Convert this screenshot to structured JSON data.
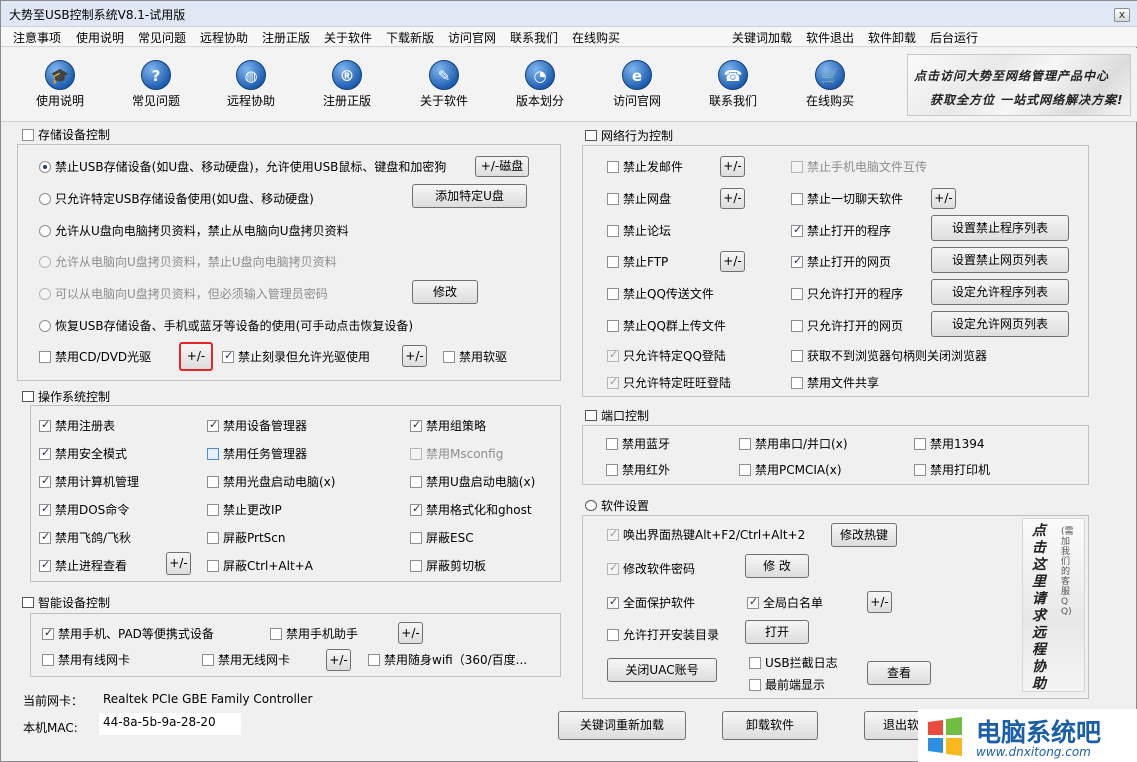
{
  "window": {
    "title": "大势至USB控制系统V8.1-试用版",
    "close": "x"
  },
  "menu": [
    "注意事项",
    "使用说明",
    "常见问题",
    "远程协助",
    "注册正版",
    "关于软件",
    "下载新版",
    "访问官网",
    "联系我们",
    "在线购买"
  ],
  "menu_right": [
    "关键词加载",
    "软件退出",
    "软件卸载",
    "后台运行"
  ],
  "toolbar": [
    {
      "label": "使用说明",
      "icon": "graduation-icon",
      "glyph": "🎓"
    },
    {
      "label": "常见问题",
      "icon": "question-icon",
      "glyph": "?"
    },
    {
      "label": "远程协助",
      "icon": "globe-icon",
      "glyph": "◍"
    },
    {
      "label": "注册正版",
      "icon": "registered-icon",
      "glyph": "®"
    },
    {
      "label": "关于软件",
      "icon": "edit-icon",
      "glyph": "✎"
    },
    {
      "label": "版本划分",
      "icon": "pie-chart-icon",
      "glyph": "◔"
    },
    {
      "label": "访问官网",
      "icon": "ie-icon",
      "glyph": "e"
    },
    {
      "label": "联系我们",
      "icon": "phone-icon",
      "glyph": "☎"
    },
    {
      "label": "在线购买",
      "icon": "cart-icon",
      "glyph": "🛒"
    }
  ],
  "banner": {
    "line1": "点击访问大势至网络管理产品中心",
    "line2": "获取全方位 一站式网络解决方案!"
  },
  "storage": {
    "title": "存储设备控制",
    "options": [
      "禁止USB存储设备(如U盘、移动硬盘)，允许使用USB鼠标、键盘和加密狗",
      "只允许特定USB存储设备使用(如U盘、移动硬盘)",
      "允许从U盘向电脑拷贝资料，禁止从电脑向U盘拷贝资料",
      "允许从电脑向U盘拷贝资料，禁止U盘向电脑拷贝资料",
      "可以从电脑向U盘拷贝资料，但必须输入管理员密码",
      "恢复USB存储设备、手机或蓝牙等设备的使用(可手动点击恢复设备)"
    ],
    "btn_disk": "+/-磁盘",
    "btn_add_udisk": "添加特定U盘",
    "btn_modify": "修改",
    "cd_dvd": "禁用CD/DVD光驱",
    "btn_pm1": "+/-",
    "burn": "禁止刻录但允许光驱使用",
    "btn_pm2": "+/-",
    "floppy": "禁用软驱"
  },
  "os": {
    "title": "操作系统控制",
    "items": [
      "禁用注册表",
      "禁用设备管理器",
      "禁用组策略",
      "禁用安全模式",
      "禁用任务管理器",
      "禁用Msconfig",
      "禁用计算机管理",
      "禁用光盘启动电脑(x)",
      "禁用U盘启动电脑(x)",
      "禁用DOS命令",
      "禁止更改IP",
      "禁用格式化和ghost",
      "禁用飞鸽/飞秋",
      "屏蔽PrtScn",
      "屏蔽ESC",
      "禁止进程查看",
      "屏蔽Ctrl+Alt+A",
      "屏蔽剪切板"
    ],
    "btn_pm": "+/-"
  },
  "smart": {
    "title": "智能设备控制",
    "items": [
      "禁用手机、PAD等便携式设备",
      "禁用手机助手",
      "禁用有线网卡",
      "禁用无线网卡",
      "禁用随身wifi（360/百度..."
    ],
    "btn_pm": "+/-"
  },
  "nic": {
    "label_nic": "当前网卡：",
    "nic_value": "Realtek PCIe GBE Family Controller",
    "label_mac": "本机MAC:",
    "mac_value": "44-8a-5b-9a-28-20"
  },
  "network": {
    "title": "网络行为控制",
    "left": [
      "禁止发邮件",
      "禁止网盘",
      "禁止论坛",
      "禁止FTP",
      "禁止QQ传送文件",
      "禁止QQ群上传文件",
      "只允许特定QQ登陆",
      "只允许特定旺旺登陆"
    ],
    "right": [
      "禁止手机电脑文件互传",
      "禁止一切聊天软件",
      "禁止打开的程序",
      "禁止打开的网页",
      "只允许打开的程序",
      "只允许打开的网页",
      "获取不到浏览器句柄则关闭浏览器",
      "禁用文件共享"
    ],
    "btn_pm": "+/-",
    "btn_set_prog": "设置禁止程序列表",
    "btn_set_web": "设置禁止网页列表",
    "btn_allow_prog": "设定允许程序列表",
    "btn_allow_web": "设定允许网页列表"
  },
  "port": {
    "title": "端口控制",
    "items": [
      "禁用蓝牙",
      "禁用串口/并口(x)",
      "禁用1394",
      "禁用红外",
      "禁用PCMCIA(x)",
      "禁用打印机"
    ]
  },
  "settings": {
    "title": "软件设置",
    "hotkey": "唤出界面热键Alt+F2/Ctrl+Alt+2",
    "btn_hotkey": "修改热键",
    "pwd": "修改软件密码",
    "btn_modify": "修 改",
    "protect": "全面保护软件",
    "whitelist": "全局白名单",
    "btn_pm": "+/-",
    "install": "允许打开安装目录",
    "btn_open": "打开",
    "btn_uac": "关闭UAC账号",
    "usb_log": "USB拦截日志",
    "front": "最前端显示",
    "btn_view": "查看",
    "side_text": "点击这里请求远程协助",
    "side_small": "(需加我们的客服QQ)"
  },
  "bottom": {
    "reload": "关键词重新加载",
    "uninstall": "卸载软件",
    "exit": "退出软"
  },
  "watermark": {
    "name": "电脑系统吧",
    "url": "www.dnxitong.com"
  },
  "colors": {
    "highlight_border": "#e2262a",
    "icon_blue": "#1f5fb3",
    "watermark_blue": "#1a5ea8"
  }
}
